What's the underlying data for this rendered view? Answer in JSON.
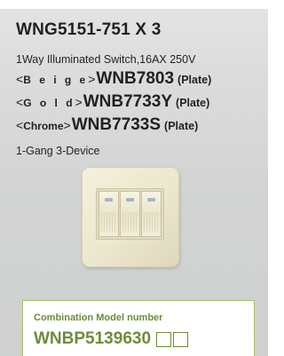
{
  "product": {
    "model_title": "WNG5151-751 X 3",
    "description": "1Way Illuminated  Switch,16AX 250V",
    "variants": [
      {
        "open": "<",
        "label": "B e i g e",
        "close": ">",
        "code": "WNB7803",
        "plate": "(Plate)"
      },
      {
        "open": "<",
        "label": "G o l d",
        "close": ">",
        "code": "WNB7733Y",
        "plate": "(Plate)"
      },
      {
        "open": "<",
        "label": "Chrome",
        "close": ">",
        "code": "WNB7733S",
        "plate": "(Plate)"
      }
    ],
    "gang": "1-Gang 3-Device"
  },
  "combination": {
    "label": "Combination Model number",
    "code": "WNBP5139630"
  },
  "colors": {
    "accent_green": "#6f8b3a",
    "panel_gray": "#d2d3d3",
    "plate_beige": "#ece7cd"
  }
}
